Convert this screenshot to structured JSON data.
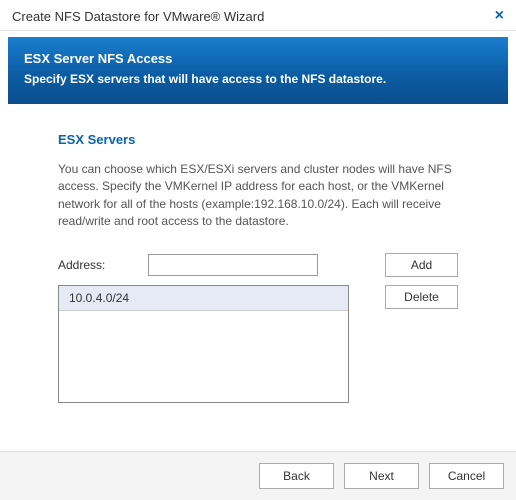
{
  "window": {
    "title": "Create NFS Datastore for VMware® Wizard"
  },
  "banner": {
    "title": "ESX Server NFS Access",
    "subtitle": "Specify ESX servers that will have access to the NFS datastore."
  },
  "section": {
    "title": "ESX Servers",
    "description": "You can choose which ESX/ESXi servers and cluster nodes will have NFS access. Specify the VMKernel IP address for each host, or the VMKernel network for all of the hosts (example:192.168.10.0/24). Each will receive read/write and root access to the datastore."
  },
  "address": {
    "label": "Address:",
    "value": ""
  },
  "buttons": {
    "add": "Add",
    "delete": "Delete",
    "back": "Back",
    "next": "Next",
    "cancel": "Cancel"
  },
  "list": {
    "items": [
      "10.0.4.0/24"
    ]
  }
}
